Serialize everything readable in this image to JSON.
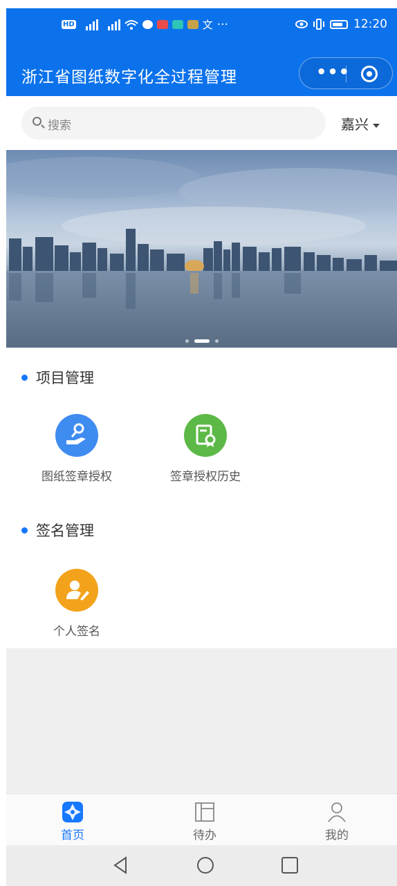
{
  "status_bar": {
    "carrier_icons": [
      "hd-icon",
      "signal-5g-icon",
      "signal-4g-icon",
      "wifi-icon",
      "wechat-icon",
      "app-icon",
      "app-icon",
      "app-icon",
      "translate-icon"
    ],
    "overflow": "···",
    "time": "12:20"
  },
  "header": {
    "title": "浙江省图纸数字化全过程管理",
    "more": "•••"
  },
  "search": {
    "placeholder": "搜索",
    "city": "嘉兴"
  },
  "banner": {
    "slide_count": 3,
    "active_index": 1
  },
  "sections": [
    {
      "title": "项目管理",
      "items": [
        {
          "label": "图纸签章授权",
          "icon": "hand-key-icon",
          "color": "#3f8cf0"
        },
        {
          "label": "签章授权历史",
          "icon": "certificate-icon",
          "color": "#5cb947"
        }
      ]
    },
    {
      "title": "签名管理",
      "items": [
        {
          "label": "个人签名",
          "icon": "user-pen-icon",
          "color": "#f3a21b"
        }
      ]
    }
  ],
  "tabbar": {
    "tabs": [
      {
        "label": "首页",
        "icon": "home-icon",
        "active": true
      },
      {
        "label": "待办",
        "icon": "todo-icon",
        "active": false
      },
      {
        "label": "我的",
        "icon": "profile-icon",
        "active": false
      }
    ],
    "active_color": "#1677ff"
  },
  "system_nav": [
    "back-icon",
    "home-circle-icon",
    "recents-icon"
  ],
  "theme": {
    "primary": "#0c72ec"
  }
}
